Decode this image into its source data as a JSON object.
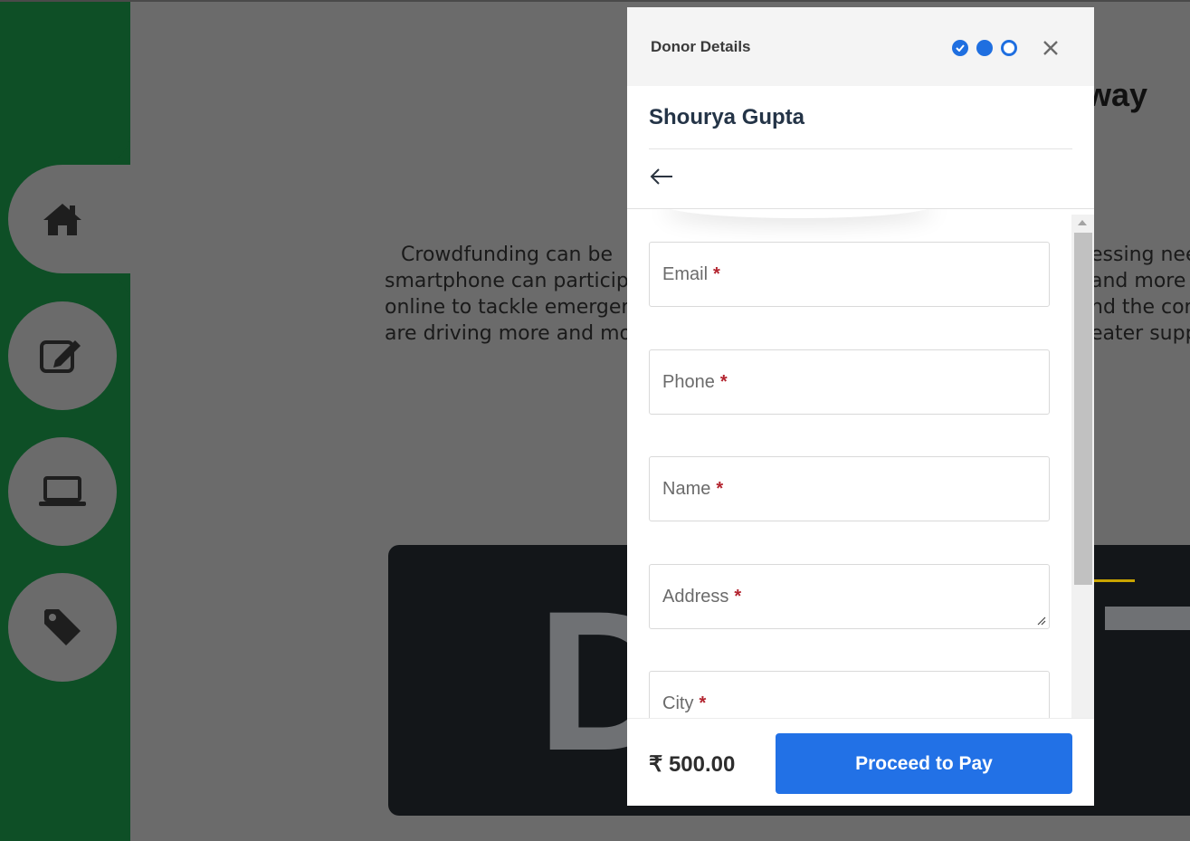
{
  "background": {
    "heading_fragment": "eway",
    "paragraph_left": [
      "Crowdfunding can be",
      "smartphone can participa",
      "online to tackle emergen",
      "are driving more and mo"
    ],
    "paragraph_right": [
      "essing nee",
      "and more",
      "nd the con",
      "eater supp"
    ],
    "banner_letter": "D"
  },
  "sidebar": {
    "items": [
      {
        "icon": "home-icon",
        "active": true
      },
      {
        "icon": "edit-icon",
        "active": false
      },
      {
        "icon": "laptop-icon",
        "active": false
      },
      {
        "icon": "tag-icon",
        "active": false
      }
    ]
  },
  "modal": {
    "title": "Donor Details",
    "steps": [
      "completed",
      "current",
      "pending"
    ],
    "campaign_name": "Shourya Gupta",
    "fields": [
      {
        "label": "Email",
        "required": "*"
      },
      {
        "label": "Phone",
        "required": "*"
      },
      {
        "label": "Name",
        "required": "*"
      },
      {
        "label": "Address",
        "required": "*"
      },
      {
        "label": "City",
        "required": "*"
      }
    ],
    "footer": {
      "amount": "₹ 500.00",
      "pay_label": "Proceed to Pay"
    }
  },
  "colors": {
    "sidebar": "#0e4f26",
    "accent": "#2271e6",
    "required": "#b3242f"
  }
}
